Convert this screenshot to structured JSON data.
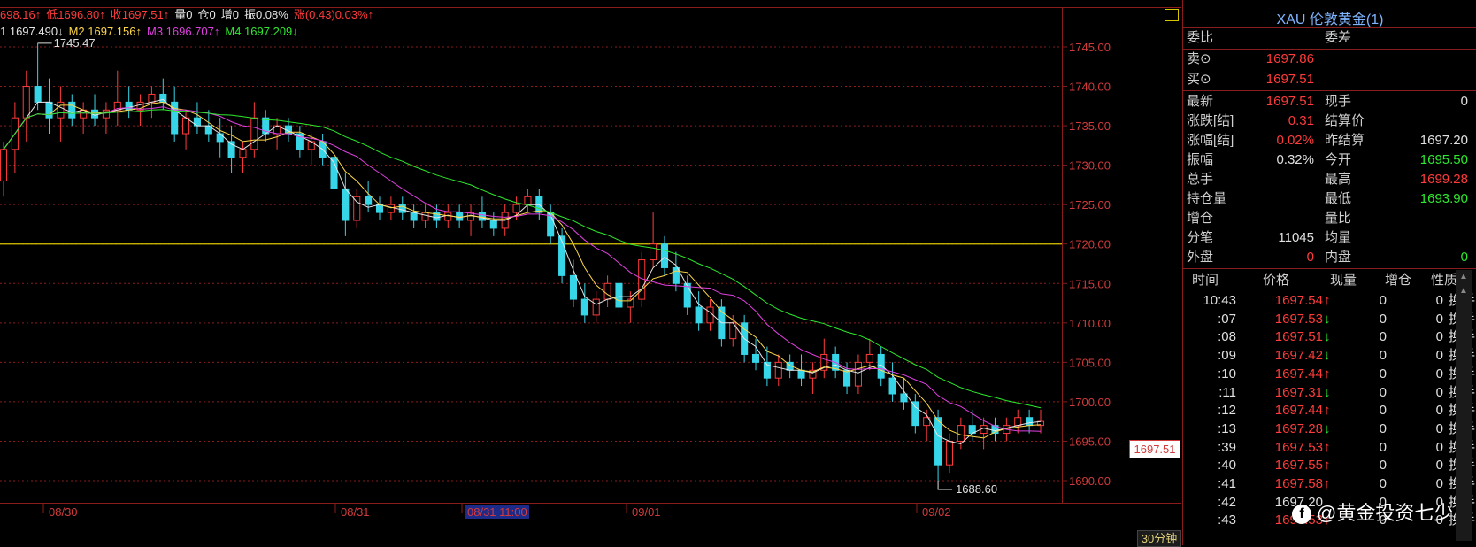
{
  "header": {
    "open_prefix": "698.16↑",
    "low": "低1696.80↑",
    "close": "收1697.51↑",
    "volume": "量0",
    "open_interest": "仓0",
    "increase": "增0",
    "amplitude": "振0.08%",
    "change": "涨(0.43)0.03%↑"
  },
  "ma_row": {
    "m1": "1 1697.490↓",
    "m2": "M2 1697.156↑",
    "m3": "M3 1696.707↑",
    "m4": "M4 1697.209↓"
  },
  "colors": {
    "up": "#ff3b3b",
    "down": "#36d6e8",
    "ma1": "#e6e6e6",
    "ma2": "#ffd84a",
    "ma3": "#e040e0",
    "ma4": "#2ee82e",
    "grid": "#8a1c1c",
    "ref_line": "#d8c600"
  },
  "chart_data": {
    "type": "candlestick",
    "y_axis_ticks": [
      "1745.00",
      "1740.00",
      "1735.00",
      "1730.00",
      "1725.00",
      "1720.00",
      "1715.00",
      "1710.00",
      "1705.00",
      "1700.00",
      "1695.00",
      "1690.00"
    ],
    "ylim": [
      1688,
      1750
    ],
    "x_labels": [
      "08/30",
      "08/31",
      "08/31 11:00",
      "09/01",
      "09/02"
    ],
    "reference_line": 1720,
    "annotations": {
      "high": "1745.47",
      "low": "1688.60"
    },
    "last_price": "1697.51",
    "period": "30分钟",
    "candles": [
      [
        1728,
        1733,
        1726,
        1732
      ],
      [
        1732,
        1738,
        1729,
        1736
      ],
      [
        1736,
        1742,
        1733,
        1740
      ],
      [
        1740,
        1745.47,
        1737,
        1738
      ],
      [
        1738,
        1741,
        1734,
        1736
      ],
      [
        1736,
        1740,
        1733,
        1738
      ],
      [
        1738,
        1739,
        1735,
        1736
      ],
      [
        1736,
        1738,
        1734,
        1737
      ],
      [
        1737,
        1739,
        1735,
        1736
      ],
      [
        1736,
        1738,
        1734,
        1737
      ],
      [
        1737,
        1742,
        1735,
        1738
      ],
      [
        1738,
        1740,
        1736,
        1737
      ],
      [
        1737,
        1739,
        1735,
        1738
      ],
      [
        1738,
        1740,
        1736,
        1739
      ],
      [
        1739,
        1741,
        1737,
        1738
      ],
      [
        1738,
        1740,
        1733,
        1734
      ],
      [
        1734,
        1737,
        1732,
        1736
      ],
      [
        1736,
        1738,
        1734,
        1735
      ],
      [
        1735,
        1737,
        1733,
        1734
      ],
      [
        1734,
        1736,
        1731,
        1733
      ],
      [
        1733,
        1735,
        1729,
        1731
      ],
      [
        1731,
        1733,
        1729,
        1732
      ],
      [
        1732,
        1738,
        1731,
        1736
      ],
      [
        1736,
        1737,
        1733,
        1734
      ],
      [
        1734,
        1736,
        1732,
        1735
      ],
      [
        1735,
        1736,
        1733,
        1734
      ],
      [
        1734,
        1735,
        1731,
        1732
      ],
      [
        1732,
        1734,
        1730,
        1733
      ],
      [
        1733,
        1734,
        1730,
        1731
      ],
      [
        1731,
        1733,
        1726,
        1727
      ],
      [
        1727,
        1729,
        1721,
        1723
      ],
      [
        1723,
        1727,
        1722,
        1726
      ],
      [
        1726,
        1728,
        1724,
        1725
      ],
      [
        1725,
        1726,
        1723,
        1724
      ],
      [
        1724,
        1726,
        1723,
        1725
      ],
      [
        1725,
        1726,
        1723,
        1724
      ],
      [
        1724,
        1725,
        1722,
        1723
      ],
      [
        1723,
        1725,
        1722,
        1724
      ],
      [
        1724,
        1725,
        1722,
        1723
      ],
      [
        1723,
        1725,
        1722,
        1724
      ],
      [
        1724,
        1725,
        1722,
        1723
      ],
      [
        1723,
        1725,
        1721,
        1724
      ],
      [
        1724,
        1726,
        1722,
        1723
      ],
      [
        1723,
        1724,
        1721,
        1722
      ],
      [
        1722,
        1725,
        1721,
        1724
      ],
      [
        1724,
        1726,
        1723,
        1725
      ],
      [
        1725,
        1727,
        1724,
        1726
      ],
      [
        1726,
        1727,
        1723,
        1724
      ],
      [
        1724,
        1725,
        1720,
        1721
      ],
      [
        1721,
        1722,
        1715,
        1716
      ],
      [
        1716,
        1718,
        1712,
        1713
      ],
      [
        1713,
        1715,
        1710,
        1711
      ],
      [
        1711,
        1714,
        1710,
        1713
      ],
      [
        1713,
        1716,
        1712,
        1715
      ],
      [
        1715,
        1716,
        1711,
        1712
      ],
      [
        1712,
        1714,
        1710,
        1713
      ],
      [
        1713,
        1719,
        1712,
        1718
      ],
      [
        1718,
        1724,
        1717,
        1720
      ],
      [
        1720,
        1721,
        1716,
        1717
      ],
      [
        1717,
        1719,
        1714,
        1715
      ],
      [
        1715,
        1716,
        1711,
        1712
      ],
      [
        1712,
        1714,
        1709,
        1710
      ],
      [
        1710,
        1713,
        1709,
        1712
      ],
      [
        1712,
        1713,
        1707,
        1708
      ],
      [
        1708,
        1711,
        1707,
        1710
      ],
      [
        1710,
        1711,
        1705,
        1706
      ],
      [
        1706,
        1708,
        1704,
        1705
      ],
      [
        1705,
        1707,
        1702,
        1703
      ],
      [
        1703,
        1706,
        1702,
        1705
      ],
      [
        1705,
        1706,
        1703,
        1704
      ],
      [
        1704,
        1706,
        1702,
        1703
      ],
      [
        1703,
        1705,
        1701,
        1704
      ],
      [
        1704,
        1708,
        1703,
        1706
      ],
      [
        1706,
        1707,
        1703,
        1704
      ],
      [
        1704,
        1705,
        1701,
        1702
      ],
      [
        1702,
        1706,
        1701,
        1705
      ],
      [
        1705,
        1708,
        1704,
        1706
      ],
      [
        1706,
        1707,
        1702,
        1703
      ],
      [
        1703,
        1705,
        1700,
        1701
      ],
      [
        1701,
        1703,
        1699,
        1700
      ],
      [
        1700,
        1701,
        1696,
        1697
      ],
      [
        1697,
        1699,
        1695,
        1698
      ],
      [
        1698,
        1699,
        1690,
        1692
      ],
      [
        1692,
        1696,
        1691,
        1695
      ],
      [
        1695,
        1698,
        1694,
        1697
      ],
      [
        1697,
        1699,
        1695,
        1696
      ],
      [
        1696,
        1698,
        1694,
        1697
      ],
      [
        1697,
        1698,
        1695,
        1696
      ],
      [
        1696,
        1698,
        1695,
        1697
      ],
      [
        1697,
        1699,
        1696,
        1698
      ],
      [
        1698,
        1699,
        1696,
        1697
      ],
      [
        1697,
        1699,
        1696,
        1697.51
      ]
    ]
  },
  "panel": {
    "title": "XAU 伦敦黄金(1)",
    "weibi_label": "委比",
    "weicha_label": "委差",
    "sell_label": "卖⊙",
    "sell_value": "1697.86",
    "buy_label": "买⊙",
    "buy_value": "1697.51",
    "rows": [
      {
        "l1": "最新",
        "v1": "1697.51",
        "l2": "现手",
        "v2": "0",
        "c1": "#ff3b3b",
        "c2": "#e0e0e0"
      },
      {
        "l1": "涨跌[结]",
        "v1": "0.31",
        "l2": "结算价",
        "v2": "",
        "c1": "#ff3b3b",
        "c2": "#e0e0e0"
      },
      {
        "l1": "涨幅[结]",
        "v1": "0.02%",
        "l2": "昨结算",
        "v2": "1697.20",
        "c1": "#ff3b3b",
        "c2": "#e0e0e0"
      },
      {
        "l1": "振幅",
        "v1": "0.32%",
        "l2": "今开",
        "v2": "1695.50",
        "c1": "#e0e0e0",
        "c2": "#2ee82e"
      },
      {
        "l1": "总手",
        "v1": "",
        "l2": "最高",
        "v2": "1699.28",
        "c1": "#e0e0e0",
        "c2": "#ff3b3b"
      },
      {
        "l1": "持仓量",
        "v1": "",
        "l2": "最低",
        "v2": "1693.90",
        "c1": "#e0e0e0",
        "c2": "#2ee82e"
      },
      {
        "l1": "增仓",
        "v1": "",
        "l2": "量比",
        "v2": "",
        "c1": "#e0e0e0",
        "c2": "#e0e0e0"
      },
      {
        "l1": "分笔",
        "v1": "11045",
        "l2": "均量",
        "v2": "",
        "c1": "#e0e0e0",
        "c2": "#e0e0e0"
      },
      {
        "l1": "外盘",
        "v1": "0",
        "l2": "内盘",
        "v2": "0",
        "c1": "#ff3b3b",
        "c2": "#2ee82e"
      }
    ],
    "tick_headers": [
      "时间",
      "价格",
      "现量",
      "增仓",
      "性质"
    ],
    "ticks": [
      {
        "time": "10:43",
        "price": "1697.54",
        "arrow": "↑",
        "vol": "0",
        "oi": "0",
        "nature": "换手"
      },
      {
        "time": ":07",
        "price": "1697.53",
        "arrow": "↓",
        "vol": "0",
        "oi": "0",
        "nature": "换手"
      },
      {
        "time": ":08",
        "price": "1697.51",
        "arrow": "↓",
        "vol": "0",
        "oi": "0",
        "nature": "换手"
      },
      {
        "time": ":09",
        "price": "1697.42",
        "arrow": "↓",
        "vol": "0",
        "oi": "0",
        "nature": "换手"
      },
      {
        "time": ":10",
        "price": "1697.44",
        "arrow": "↑",
        "vol": "0",
        "oi": "0",
        "nature": "换手"
      },
      {
        "time": ":11",
        "price": "1697.31",
        "arrow": "↓",
        "vol": "0",
        "oi": "0",
        "nature": "换手"
      },
      {
        "time": ":12",
        "price": "1697.44",
        "arrow": "↑",
        "vol": "0",
        "oi": "0",
        "nature": "换手"
      },
      {
        "time": ":13",
        "price": "1697.28",
        "arrow": "↓",
        "vol": "0",
        "oi": "0",
        "nature": "换手"
      },
      {
        "time": ":39",
        "price": "1697.53",
        "arrow": "↑",
        "vol": "0",
        "oi": "0",
        "nature": "换手"
      },
      {
        "time": ":40",
        "price": "1697.55",
        "arrow": "↑",
        "vol": "0",
        "oi": "0",
        "nature": "换手"
      },
      {
        "time": ":41",
        "price": "1697.58",
        "arrow": "↑",
        "vol": "0",
        "oi": "0",
        "nature": "换手"
      },
      {
        "time": ":42",
        "price": "1697.20",
        "arrow": "",
        "vol": "0",
        "oi": "0",
        "nature": "换手"
      },
      {
        "time": ":43",
        "price": "1697.53",
        "arrow": "↑",
        "vol": "0",
        "oi": "0",
        "nature": "换手"
      }
    ]
  },
  "watermark": "@黄金投资七少",
  "watermark_icon": "f"
}
